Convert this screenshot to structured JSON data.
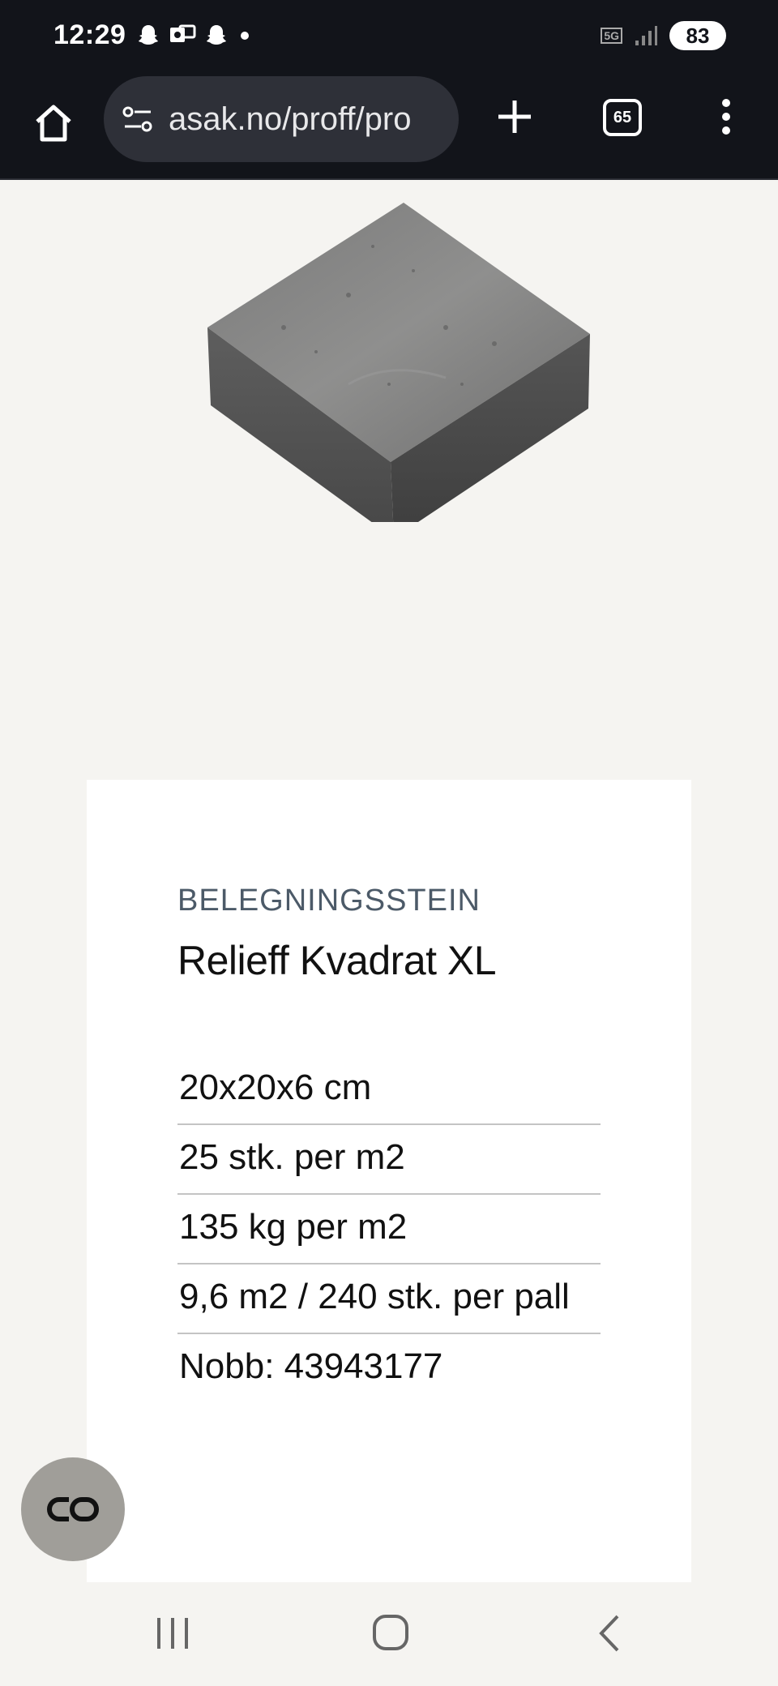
{
  "status_bar": {
    "time": "12:29",
    "network": "5G",
    "battery": "83"
  },
  "browser": {
    "url": "asak.no/proff/pro",
    "tab_count": "65"
  },
  "product": {
    "category": "BELEGNINGSSTEIN",
    "name": "Relieff Kvadrat XL",
    "specs": [
      "20x20x6 cm",
      "25 stk. per m2",
      "135 kg per m2",
      "9,6 m2 / 240 stk. per pall",
      "Nobb: 43943177"
    ]
  },
  "colors": {
    "page_bg": "#f5f4f1",
    "bar_bg": "#12141a",
    "category_text": "#4c5a68"
  }
}
